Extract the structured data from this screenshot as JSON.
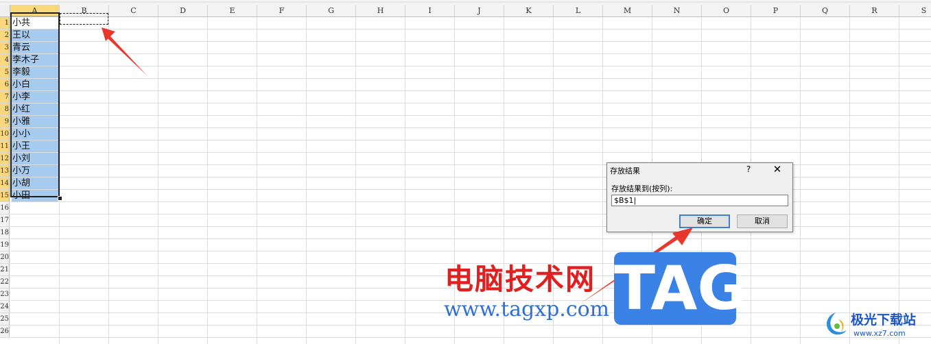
{
  "columns": [
    "A",
    "B",
    "C",
    "D",
    "E",
    "F",
    "G",
    "H",
    "I",
    "J",
    "K",
    "L",
    "M",
    "N",
    "O",
    "P",
    "Q",
    "R",
    "S"
  ],
  "selected_column": "A",
  "row_numbers": [
    "1",
    "2",
    "3",
    "4",
    "5",
    "6",
    "7",
    "8",
    "9",
    "10",
    "11",
    "12",
    "13",
    "14",
    "15",
    "16",
    "17",
    "18",
    "19",
    "20",
    "21",
    "22",
    "23",
    "24",
    "25",
    "26"
  ],
  "column_a": [
    "小共",
    "王以",
    "青云",
    "李木子",
    "李毅",
    "小白",
    "小李",
    "小红",
    "小雅",
    "小小",
    "小王",
    "小刘",
    "小万",
    "小胡",
    "小田"
  ],
  "dialog": {
    "title": "存放结果",
    "help": "?",
    "close": "✕",
    "label": "存放结果到(按列):",
    "value": "$B$1|",
    "ok": "确定",
    "cancel": "取消"
  },
  "watermark": {
    "site_name": "电脑技术网",
    "url": "www.tagxp.com",
    "tag": "TAG"
  },
  "brand": {
    "name": "极光下载站",
    "url": "www.xz7.com"
  },
  "colors": {
    "selection_highlight": "#a6cbef",
    "header_selected": "#f9d77c",
    "arrow_red": "#e8382e",
    "dialog_ok_border": "#3b7fd6"
  }
}
